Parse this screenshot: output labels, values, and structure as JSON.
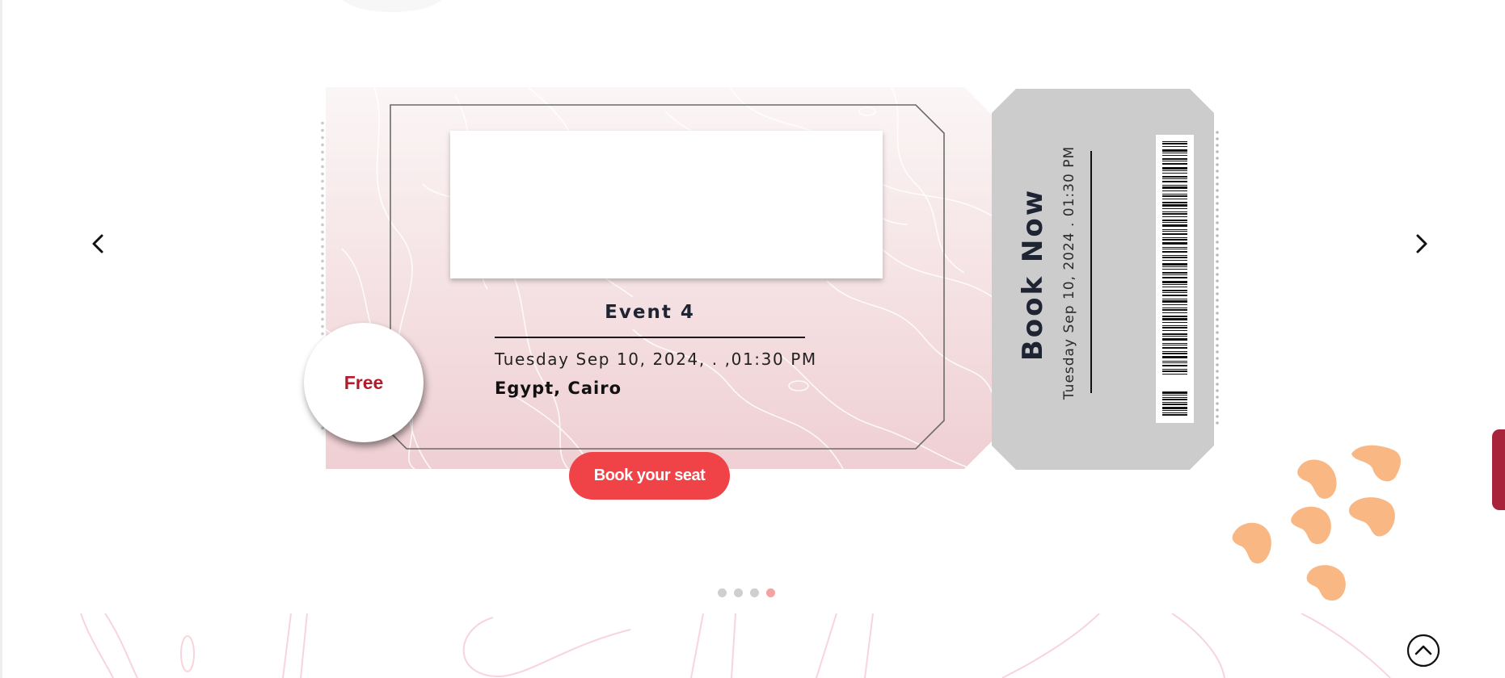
{
  "colors": {
    "accent": "#ef4347",
    "price_text": "#b31b2a",
    "stub_bg": "#cccccc",
    "ticket_top": "#fbf5f5",
    "ticket_bottom": "#efcfd2",
    "side_tab": "#a8243a",
    "decoration": "#f9b784",
    "dot_active": "#f4a2a2",
    "dot_inactive": "#cfcfcf"
  },
  "carousel": {
    "prev_icon": "chevron-left-icon",
    "next_icon": "chevron-right-icon",
    "slide_count": 4,
    "active_slide": 4
  },
  "ticket": {
    "title": "Event 4",
    "date": "Tuesday Sep 10, 2024, . ,01:30 PM",
    "location": "Egypt, Cairo",
    "price": "Free",
    "book_button": "Book your seat"
  },
  "stub": {
    "heading": "Book Now",
    "date": "Tuesday Sep 10, 2024 . 01:30 PM",
    "barcode_icon": "barcode-icon"
  },
  "scroll_top_icon": "chevron-up-circle-icon"
}
